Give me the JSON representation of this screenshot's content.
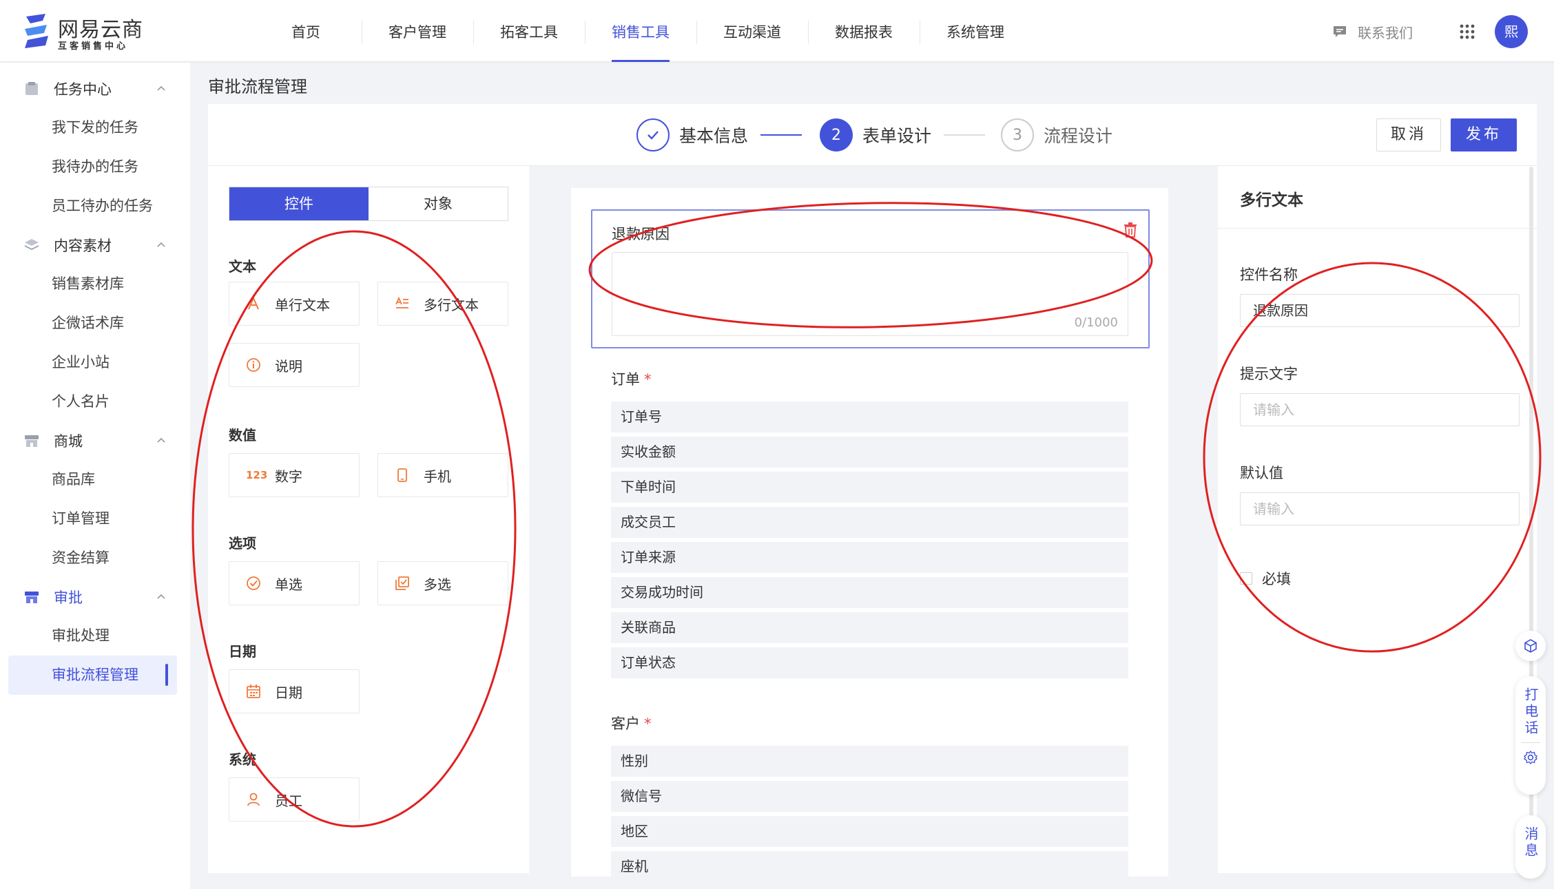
{
  "colors": {
    "accent": "#4353d9",
    "annotation": "#e02020",
    "icon_orange": "#f07a3c",
    "required": "#e94545"
  },
  "brand": {
    "name": "网易云商",
    "subtitle": "互客销售中心"
  },
  "nav": {
    "items": [
      "首页",
      "客户管理",
      "拓客工具",
      "销售工具",
      "互动渠道",
      "数据报表",
      "系统管理"
    ],
    "active": "销售工具"
  },
  "header": {
    "contact_label": "联系我们",
    "avatar_text": "熙"
  },
  "sidebar": {
    "groups": [
      {
        "label": "任务中心",
        "icon": "task-icon",
        "items": [
          "我下发的任务",
          "我待办的任务",
          "员工待办的任务"
        ]
      },
      {
        "label": "内容素材",
        "icon": "layers-icon",
        "items": [
          "销售素材库",
          "企微话术库",
          "企业小站",
          "个人名片"
        ]
      },
      {
        "label": "商城",
        "icon": "store-icon",
        "items": [
          "商品库",
          "订单管理",
          "资金结算"
        ]
      },
      {
        "label": "审批",
        "icon": "approval-icon",
        "items": [
          "审批处理",
          "审批流程管理"
        ]
      }
    ],
    "active_item": "审批流程管理"
  },
  "page": {
    "title": "审批流程管理"
  },
  "steps": [
    {
      "label": "基本信息",
      "state": "done"
    },
    {
      "number": "2",
      "label": "表单设计",
      "state": "current"
    },
    {
      "number": "3",
      "label": "流程设计",
      "state": "todo"
    }
  ],
  "actions": {
    "cancel": "取消",
    "publish": "发布"
  },
  "palette": {
    "tabs": [
      "控件",
      "对象"
    ],
    "active_tab": "控件",
    "categories": [
      {
        "title": "文本",
        "controls": [
          {
            "label": "单行文本",
            "icon": "single-line-text-icon"
          },
          {
            "label": "多行文本",
            "icon": "multi-line-text-icon"
          },
          {
            "label": "说明",
            "icon": "info-icon"
          }
        ]
      },
      {
        "title": "数值",
        "controls": [
          {
            "label": "数字",
            "icon": "number-icon",
            "glyph": "123"
          },
          {
            "label": "手机",
            "icon": "phone-icon"
          }
        ]
      },
      {
        "title": "选项",
        "controls": [
          {
            "label": "单选",
            "icon": "radio-icon"
          },
          {
            "label": "多选",
            "icon": "checkbox-icon"
          }
        ]
      },
      {
        "title": "日期",
        "controls": [
          {
            "label": "日期",
            "icon": "calendar-icon"
          }
        ]
      },
      {
        "title": "系统",
        "controls": [
          {
            "label": "员工",
            "icon": "user-icon"
          }
        ]
      }
    ]
  },
  "form": {
    "selected_field": {
      "label": "退款原因",
      "counter": "0/1000"
    },
    "groups": [
      {
        "label": "订单",
        "required": true,
        "fields": [
          "订单号",
          "实收金额",
          "下单时间",
          "成交员工",
          "订单来源",
          "交易成功时间",
          "关联商品",
          "订单状态"
        ]
      },
      {
        "label": "客户",
        "required": true,
        "fields": [
          "性别",
          "微信号",
          "地区",
          "座机"
        ]
      }
    ]
  },
  "properties": {
    "title": "多行文本",
    "name_label": "控件名称",
    "name_value": "退款原因",
    "hint_label": "提示文字",
    "hint_placeholder": "请输入",
    "default_label": "默认值",
    "default_placeholder": "请输入",
    "required_label": "必填"
  },
  "floating": {
    "call_label": "打电话",
    "message_label": "消息"
  }
}
